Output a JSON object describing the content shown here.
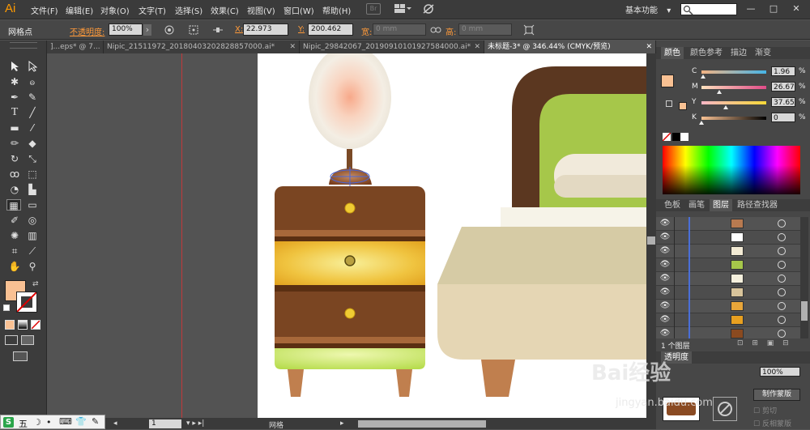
{
  "app": {
    "logo": "Ai"
  },
  "menu": {
    "items": [
      "文件(F)",
      "编辑(E)",
      "对象(O)",
      "文字(T)",
      "选择(S)",
      "效果(C)",
      "视图(V)",
      "窗口(W)",
      "帮助(H)"
    ],
    "bridge": "Br"
  },
  "workspace": {
    "label": "基本功能",
    "chevron": "▾"
  },
  "search": {
    "placeholder": ""
  },
  "window_controls": {
    "minimize": "—",
    "maximize": "□",
    "close": "✕"
  },
  "control_bar": {
    "tool_name": "网格点",
    "opacity_label": "不透明度:",
    "opacity_value": "100%",
    "x_label": "X:",
    "x_value": "22.973",
    "y_label": "Y:",
    "y_value": "200.462",
    "w_label": "宽:",
    "w_value": "0 mm",
    "h_label": "高:",
    "h_value": "0 mm"
  },
  "tabs": [
    {
      "label": "]...eps* @ 7...",
      "active": false
    },
    {
      "label": "Nipic_21511972_20180403202828857000.ai*",
      "active": false
    },
    {
      "label": "Nipic_29842067_20190910101927584000.ai*",
      "active": false
    },
    {
      "label": "未标题-3* @ 346.44% (CMYK/预览)",
      "active": true
    }
  ],
  "color_panel": {
    "tabs": [
      "颜色",
      "颜色参考",
      "描边",
      "渐变"
    ],
    "channels": [
      {
        "name": "C",
        "value": "1.96",
        "ratio": 0.02
      },
      {
        "name": "M",
        "value": "26.67",
        "ratio": 0.27
      },
      {
        "name": "Y",
        "value": "37.65",
        "ratio": 0.38
      },
      {
        "name": "K",
        "value": "0",
        "ratio": 0.0
      }
    ],
    "fill_color": "#f9c193"
  },
  "layers_panel": {
    "tabs": [
      "色板",
      "画笔",
      "图层",
      "路径查找器"
    ],
    "rows": [
      {
        "thumb": "#b87a50"
      },
      {
        "thumb": "#ffffff"
      },
      {
        "thumb": "#f2ead4"
      },
      {
        "thumb": "#a6c74a"
      },
      {
        "thumb": "#f5f0dd"
      },
      {
        "thumb": "#d8c49b"
      },
      {
        "thumb": "#e8a63a"
      },
      {
        "thumb": "#e8a020"
      },
      {
        "thumb": "#8a4a20"
      },
      {
        "thumb": "#6a3a1a"
      }
    ],
    "count_label": "1 个图层"
  },
  "transparency_panel": {
    "tab": "透明度",
    "opacity": "100%",
    "make_mask": "制作蒙版",
    "clip": "剪切",
    "invert": "反相蒙版"
  },
  "status_bar": {
    "zoom_value": "1",
    "tool_status": "网格"
  },
  "watermark": {
    "main": "Bai经验",
    "sub": "jingyan.baidu.com"
  },
  "ime_bar": {
    "items": [
      "S",
      "五",
      "☽",
      "•",
      "⌨",
      "👕",
      "✎"
    ]
  }
}
